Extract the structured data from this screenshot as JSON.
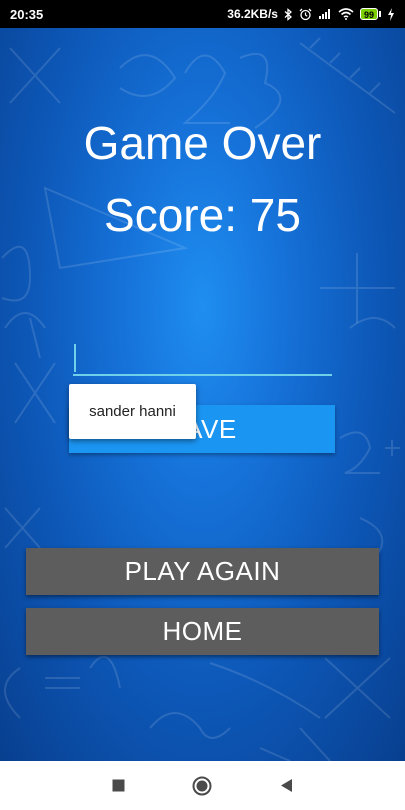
{
  "status_bar": {
    "time": "20:35",
    "net_speed": "36.2KB/s",
    "battery": "99",
    "icons": [
      "bluetooth-icon",
      "alarm-icon",
      "signal-4g-icon",
      "wifi-icon",
      "battery-icon",
      "charging-icon"
    ]
  },
  "game_over": {
    "title": "Game Over",
    "score_text": "Score: 75"
  },
  "name_input": {
    "value": "",
    "placeholder": ""
  },
  "autofill_suggestion": {
    "label": "sander hanni"
  },
  "buttons": {
    "save": "SAVE",
    "play_again": "PLAY AGAIN",
    "home": "HOME"
  },
  "nav_bar": {
    "icons": [
      "recents-square-icon",
      "home-circle-icon",
      "back-triangle-icon"
    ]
  },
  "colors": {
    "save_button": "#1b95f2",
    "secondary_button": "#5d5d5d",
    "input_underline": "#6fd0ea",
    "battery": "#7cd000"
  }
}
